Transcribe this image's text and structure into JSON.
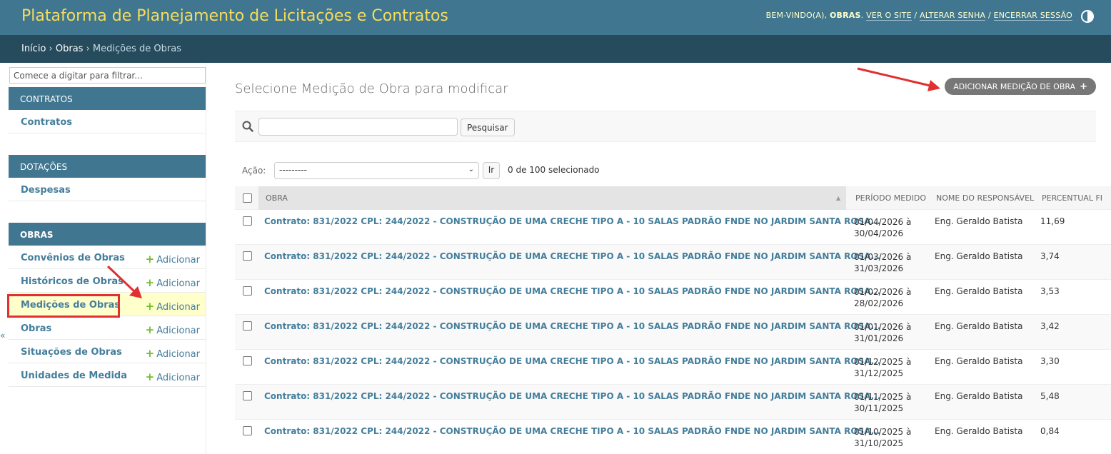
{
  "header": {
    "brand": "Plataforma de Planejamento de Licitações e Contratos",
    "welcome": "Bem-vindo(a),",
    "username": "obras",
    "links": [
      "Ver o site",
      "Alterar senha",
      "Encerrar sessão"
    ]
  },
  "breadcrumbs": {
    "home": "Início",
    "section": "Obras",
    "current": "Medições de Obras"
  },
  "sidebar": {
    "filter_placeholder": "Comece a digitar para filtrar...",
    "add_label": "Adicionar",
    "modules": [
      {
        "caption": "Contratos",
        "items": [
          "Contratos"
        ]
      },
      {
        "caption": "Dotações",
        "items": [
          "Despesas"
        ]
      },
      {
        "caption": "Obras",
        "items": [
          "Convênios de Obras",
          "Históricos de Obras",
          "Medições de Obras",
          "Obras",
          "Situações de Obras",
          "Unidades de Medida"
        ]
      }
    ],
    "collapse_glyph": "«"
  },
  "content": {
    "title": "Selecione Medição de Obra para modificar",
    "add_button": "Adicionar Medição de Obra",
    "search_button": "Pesquisar",
    "action_label": "Ação:",
    "action_select_value": "---------",
    "go_button": "Ir",
    "action_counter": "0 de 100 selecionado",
    "columns": [
      "Obra",
      "Período medido",
      "Nome do responsável",
      "Percentual fi"
    ],
    "rows": [
      {
        "obra": "Contrato: 831/2022 CPL: 244/2022 - CONSTRUÇÃO DE UMA CRECHE TIPO A - 10 SALAS PADRÃO FNDE NO JARDIM SANTA ROSA...",
        "periodo_1": "01/04/2026 à",
        "periodo_2": "30/04/2026",
        "responsavel": "Eng. Geraldo Batista",
        "percentual": "11,69"
      },
      {
        "obra": "Contrato: 831/2022 CPL: 244/2022 - CONSTRUÇÃO DE UMA CRECHE TIPO A - 10 SALAS PADRÃO FNDE NO JARDIM SANTA ROSA...",
        "periodo_1": "01/03/2026 à",
        "periodo_2": "31/03/2026",
        "responsavel": "Eng. Geraldo Batista",
        "percentual": "3,74"
      },
      {
        "obra": "Contrato: 831/2022 CPL: 244/2022 - CONSTRUÇÃO DE UMA CRECHE TIPO A - 10 SALAS PADRÃO FNDE NO JARDIM SANTA ROSA...",
        "periodo_1": "01/02/2026 à",
        "periodo_2": "28/02/2026",
        "responsavel": "Eng. Geraldo Batista",
        "percentual": "3,53"
      },
      {
        "obra": "Contrato: 831/2022 CPL: 244/2022 - CONSTRUÇÃO DE UMA CRECHE TIPO A - 10 SALAS PADRÃO FNDE NO JARDIM SANTA ROSA...",
        "periodo_1": "01/01/2026 à",
        "periodo_2": "31/01/2026",
        "responsavel": "Eng. Geraldo Batista",
        "percentual": "3,42"
      },
      {
        "obra": "Contrato: 831/2022 CPL: 244/2022 - CONSTRUÇÃO DE UMA CRECHE TIPO A - 10 SALAS PADRÃO FNDE NO JARDIM SANTA ROSA...",
        "periodo_1": "01/12/2025 à",
        "periodo_2": "31/12/2025",
        "responsavel": "Eng. Geraldo Batista",
        "percentual": "3,30"
      },
      {
        "obra": "Contrato: 831/2022 CPL: 244/2022 - CONSTRUÇÃO DE UMA CRECHE TIPO A - 10 SALAS PADRÃO FNDE NO JARDIM SANTA ROSA...",
        "periodo_1": "01/11/2025 à",
        "periodo_2": "30/11/2025",
        "responsavel": "Eng. Geraldo Batista",
        "percentual": "5,48"
      },
      {
        "obra": "Contrato: 831/2022 CPL: 244/2022 - CONSTRUÇÃO DE UMA CRECHE TIPO A - 10 SALAS PADRÃO FNDE NO JARDIM SANTA ROSA...",
        "periodo_1": "01/10/2025 à",
        "periodo_2": "31/10/2025",
        "responsavel": "Eng. Geraldo Batista",
        "percentual": "0,84"
      }
    ]
  },
  "colors": {
    "header_bg": "#417690",
    "brand_text": "#f5dd5d",
    "breadcrumbs_bg": "#264b5d",
    "link": "#447e9b",
    "add_plus": "#70bf2b",
    "current_row_bg": "#ffffcc",
    "annotation_red": "#e03030"
  }
}
